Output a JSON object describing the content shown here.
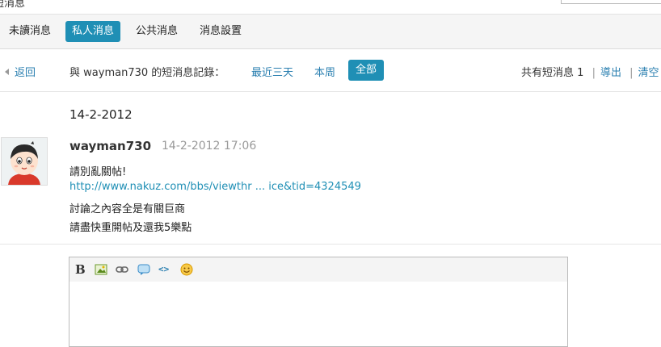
{
  "header": {
    "title": "短消息",
    "search_value": ""
  },
  "tabs": [
    {
      "label": "未讀消息"
    },
    {
      "label": "私人消息"
    },
    {
      "label": "公共消息"
    },
    {
      "label": "消息設置"
    }
  ],
  "filter": {
    "back_label": "返回",
    "prefix": "與",
    "username": "wayman730",
    "suffix": "的短消息記錄：",
    "options": [
      "最近三天",
      "本周",
      "全部"
    ],
    "total_label": "共有短消息",
    "total_count": "1",
    "export_label": "導出",
    "clear_label": "清空"
  },
  "conversation": {
    "date": "14-2-2012",
    "author": "wayman730",
    "time": "14-2-2012 17:06",
    "lines": [
      "請別亂關帖!",
      "http://www.nakuz.com/bbs/viewthr ... ice&tid=4324549",
      "討論之內容全是有關巨商",
      "請盡快重開帖及還我5樂點"
    ]
  },
  "editor": {
    "tools": [
      "bold-icon",
      "image-icon",
      "link-icon",
      "quote-icon",
      "code-icon",
      "smiley-icon"
    ],
    "bold_glyph": "B",
    "code_glyph": "<>"
  },
  "colors": {
    "accent": "#1f8fb5",
    "link": "#2a7fb0"
  }
}
